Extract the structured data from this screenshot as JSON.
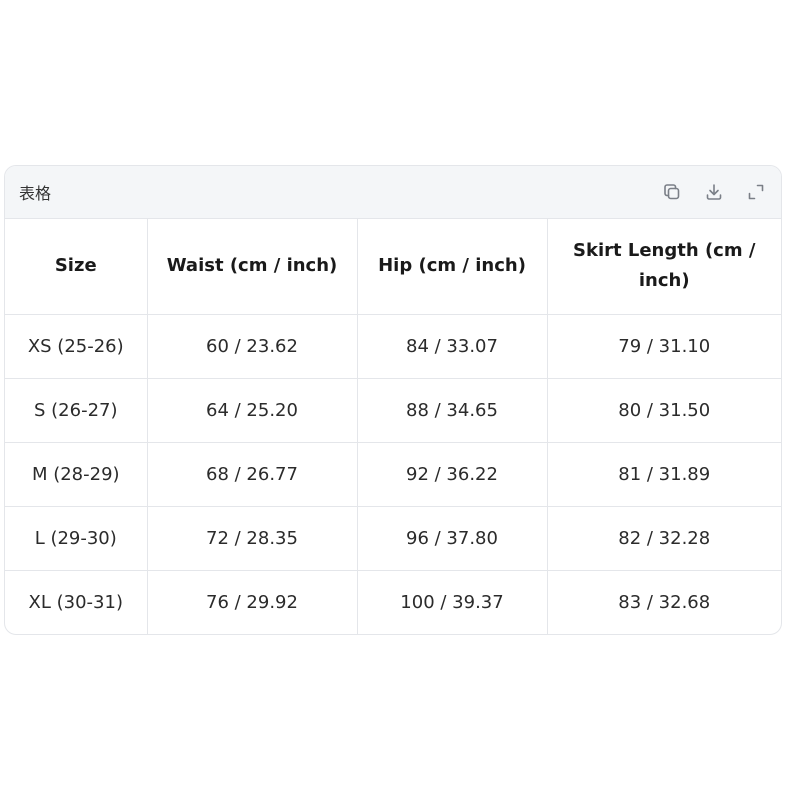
{
  "card": {
    "title": "表格",
    "actions": {
      "copy_icon": "copy-icon",
      "download_icon": "download-icon",
      "expand_icon": "expand-icon"
    }
  },
  "table": {
    "headers": [
      "Size",
      "Waist (cm / inch)",
      "Hip (cm / inch)",
      "Skirt Length (cm / inch)"
    ],
    "rows": [
      [
        "XS (25-26)",
        "60 / 23.62",
        "84 / 33.07",
        "79 / 31.10"
      ],
      [
        "S (26-27)",
        "64 / 25.20",
        "88 / 34.65",
        "80 / 31.50"
      ],
      [
        "M (28-29)",
        "68 / 26.77",
        "92 / 36.22",
        "81 / 31.89"
      ],
      [
        "L (29-30)",
        "72 / 28.35",
        "96 / 37.80",
        "82 / 32.28"
      ],
      [
        "XL (30-31)",
        "76 / 29.92",
        "100 / 39.37",
        "83 / 32.68"
      ]
    ]
  },
  "colors": {
    "header_bg": "#f4f6f8",
    "border": "#e4e6ea",
    "icon": "#7a7f87"
  }
}
